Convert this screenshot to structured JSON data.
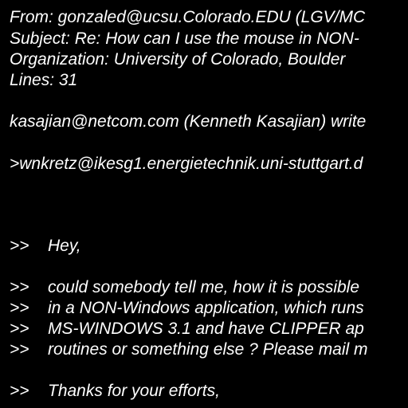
{
  "message": {
    "headers": {
      "from": "From: gonzaled@ucsu.Colorado.EDU (LGV/MC",
      "subject": "Subject: Re: How can I use the mouse in NON-",
      "organization": "Organization: University of Colorado, Boulder",
      "lines": "Lines: 31"
    },
    "attribution": "kasajian@netcom.com (Kenneth Kasajian) write",
    "nested_attribution": ">wnkretz@ikesg1.energietechnik.uni-stuttgart.d",
    "quote_marker": ">>",
    "quoted": {
      "greeting": "Hey,",
      "body": [
        "could somebody tell me, how it is possible",
        "in a NON-Windows application, which runs",
        "MS-WINDOWS 3.1 and have CLIPPER ap",
        "routines or something else ? Please mail m"
      ],
      "thanks": "Thanks for your efforts,"
    }
  },
  "colors": {
    "background": "#000000",
    "text": "#ffffff"
  }
}
